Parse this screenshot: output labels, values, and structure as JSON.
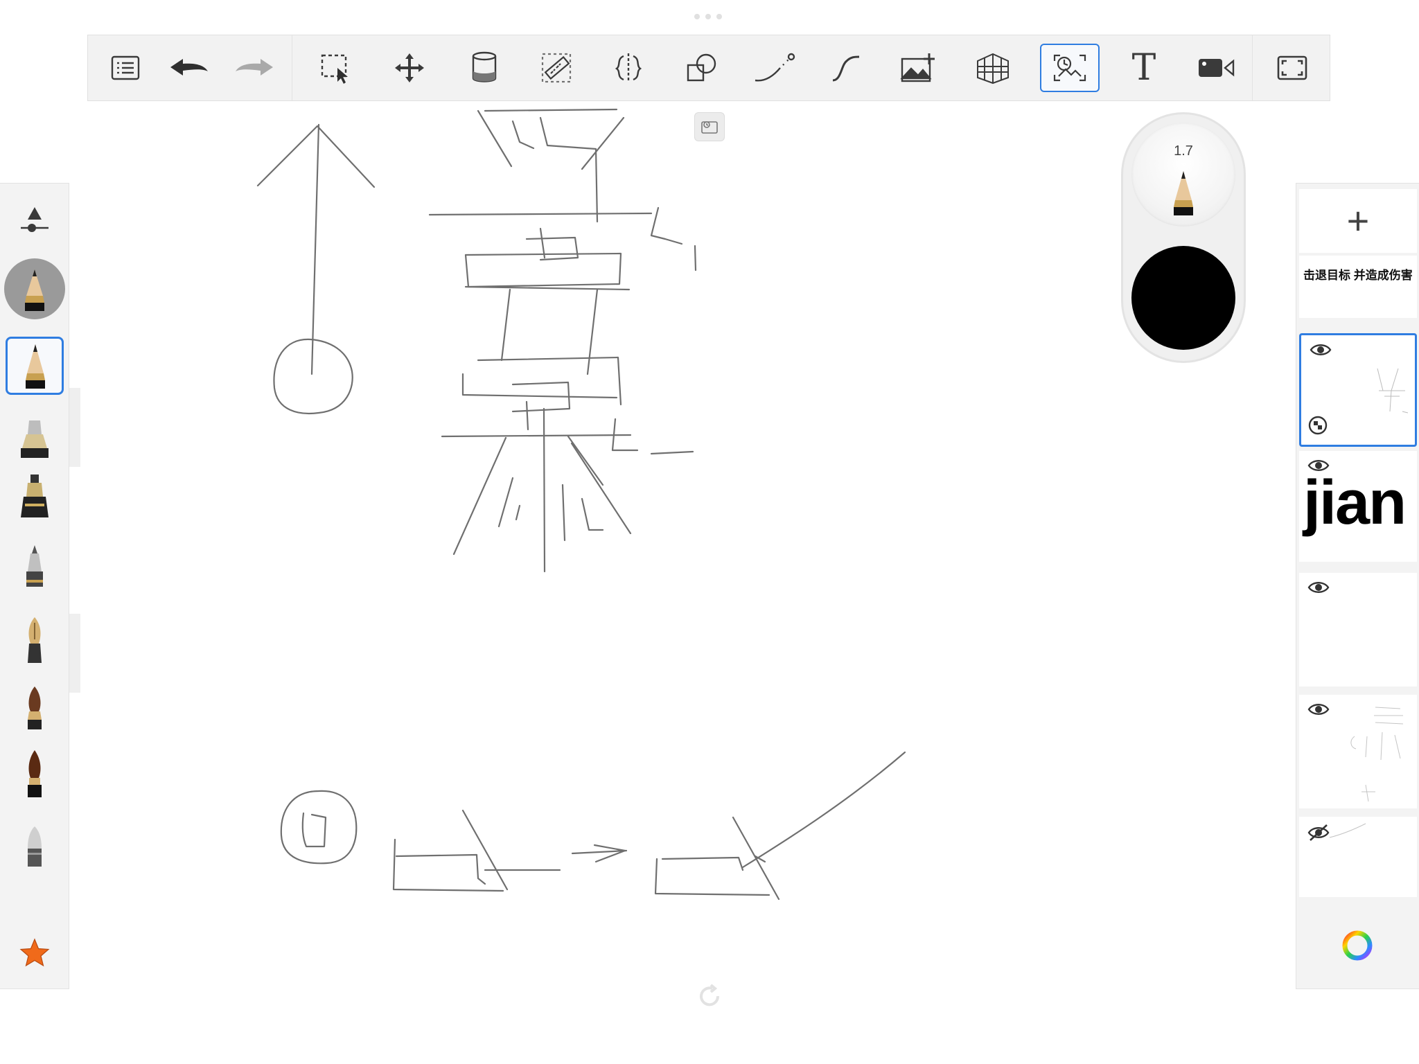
{
  "toolbar": {
    "tools": [
      {
        "id": "layers-list",
        "icon": "list-icon"
      },
      {
        "id": "undo",
        "icon": "undo-icon"
      },
      {
        "id": "redo",
        "icon": "redo-icon"
      },
      {
        "id": "selection",
        "icon": "selection-icon"
      },
      {
        "id": "transform",
        "icon": "move-icon"
      },
      {
        "id": "fill",
        "icon": "paint-bucket-icon"
      },
      {
        "id": "ruler",
        "icon": "ruler-icon"
      },
      {
        "id": "symmetry",
        "icon": "symmetry-icon"
      },
      {
        "id": "shapes",
        "icon": "shapes-icon"
      },
      {
        "id": "stroke",
        "icon": "predictive-stroke-icon"
      },
      {
        "id": "curve",
        "icon": "curve-icon"
      },
      {
        "id": "import-image",
        "icon": "add-image-icon"
      },
      {
        "id": "perspective",
        "icon": "perspective-grid-icon"
      },
      {
        "id": "time-lapse",
        "icon": "time-lapse-icon",
        "active": true
      },
      {
        "id": "text",
        "icon": "text-icon"
      },
      {
        "id": "record",
        "icon": "video-camera-icon"
      },
      {
        "id": "fullscreen",
        "icon": "fullscreen-icon"
      }
    ],
    "text_tool_label": "T"
  },
  "brush_puck": {
    "size": "1.7",
    "color": "#000000"
  },
  "left_palette": {
    "brushes": [
      "opacity-slider-icon",
      "pencil-preview",
      "pencil-brush-icon",
      "marker-brush-icon",
      "ink-pen-brush-icon",
      "airbrush-brush-icon",
      "fountain-pen-brush-icon",
      "paint-brush-icon",
      "ink-brush-icon",
      "eraser-brush-icon",
      "favorites-star-icon"
    ],
    "selected_index": 2,
    "accent": "#2f7de1"
  },
  "layers": {
    "add_label": "+",
    "items": [
      {
        "name": "text-layer",
        "title": "击退目标 并造成伤害",
        "visible": true
      },
      {
        "name": "layer-sketch",
        "visible": true,
        "selected": true
      },
      {
        "name": "layer-jian",
        "text": "jian",
        "visible": true
      },
      {
        "name": "layer-empty",
        "visible": true
      },
      {
        "name": "layer-strokes",
        "visible": true
      },
      {
        "name": "layer-hidden",
        "visible": false
      }
    ]
  },
  "colors": {
    "accent": "#2f7de1",
    "toolbar_bg": "#f2f2f2",
    "ink": "#555555"
  }
}
